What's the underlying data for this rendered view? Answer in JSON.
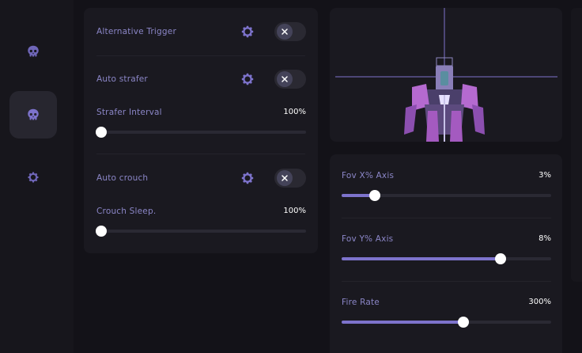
{
  "sidebar": {
    "items": [
      {
        "icon": "skull-icon",
        "active": false
      },
      {
        "icon": "skull-icon",
        "active": true
      },
      {
        "icon": "gear-icon",
        "active": false
      }
    ]
  },
  "left_panel": {
    "alt_trigger": {
      "label": "Alternative Trigger"
    },
    "auto_strafer": {
      "label": "Auto strafer"
    },
    "strafer_interval": {
      "label": "Strafer Interval",
      "value": "100%",
      "level": 0.0
    },
    "auto_crouch": {
      "label": "Auto crouch"
    },
    "crouch_sleep": {
      "label": "Crouch Sleep.",
      "value": "100%",
      "level": 0.0
    }
  },
  "right_panel": {
    "fov_x": {
      "label": "Fov X% Axis",
      "value": "3%",
      "level": 0.16
    },
    "fov_y": {
      "label": "Fov Y% Axis",
      "value": "8%",
      "level": 0.76
    },
    "fire_rate": {
      "label": "Fire Rate",
      "value": "300%",
      "level": 0.58
    }
  },
  "colors": {
    "accent": "#7d73cc",
    "label": "#8b86c7",
    "background": "#131218"
  }
}
